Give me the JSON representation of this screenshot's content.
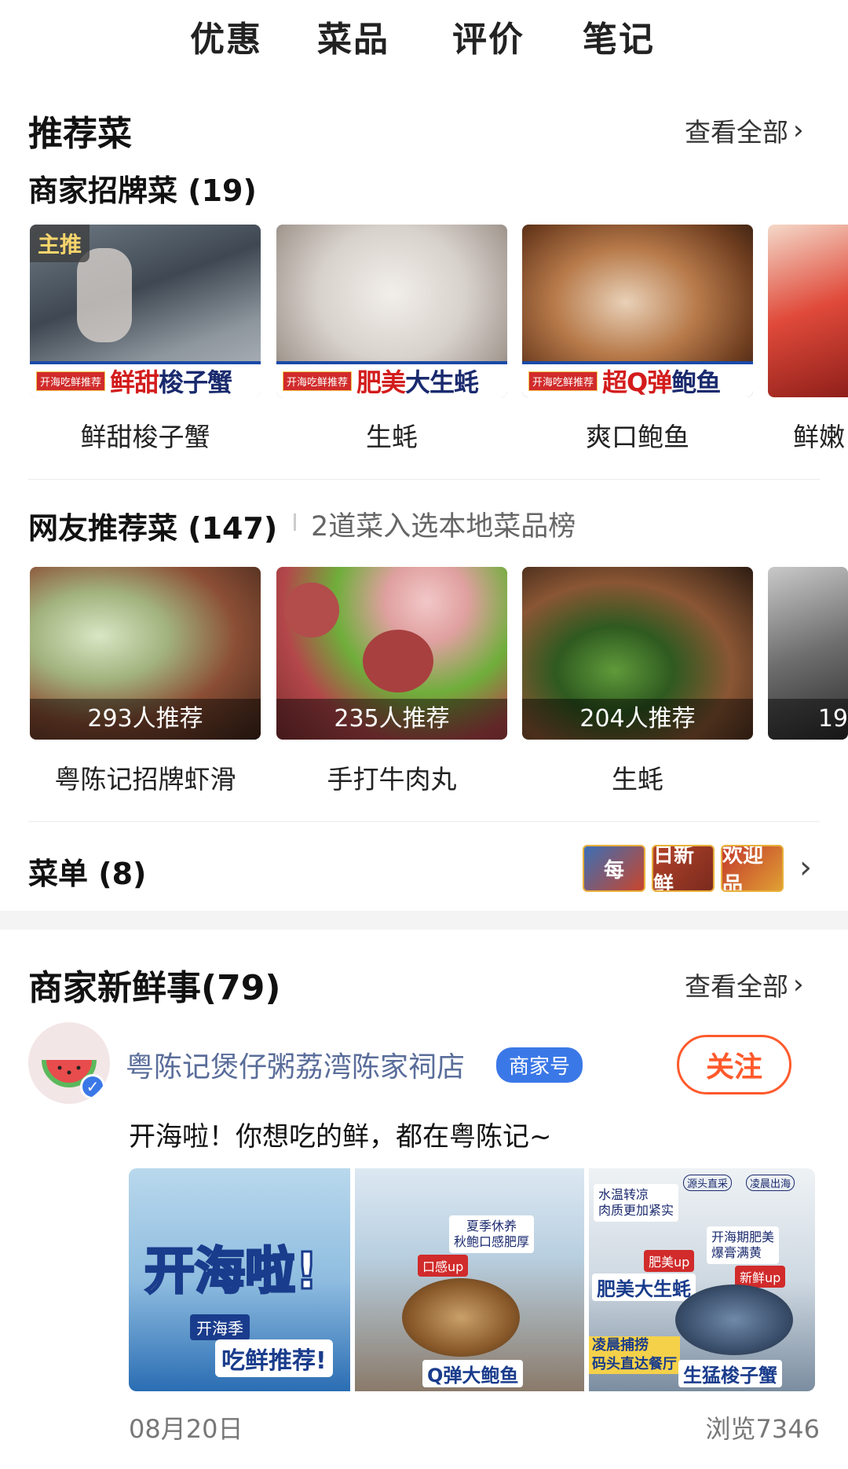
{
  "tabs": [
    "优惠",
    "菜品",
    "评价",
    "笔记"
  ],
  "recommend": {
    "title": "推荐菜",
    "view_all": "查看全部",
    "signature": {
      "title": "商家招牌菜 (19)",
      "items": [
        {
          "name": "鲜甜梭子蟹",
          "badge": "主推",
          "banner_tag": "开海吃鲜推荐",
          "banner_a": "鲜甜",
          "banner_b": "梭子蟹"
        },
        {
          "name": "生蚝",
          "badge": "",
          "banner_tag": "开海吃鲜推荐",
          "banner_a": "肥美",
          "banner_b": "大生蚝"
        },
        {
          "name": "爽口鲍鱼",
          "badge": "",
          "banner_tag": "开海吃鲜推荐",
          "banner_a": "超Q弹",
          "banner_b": "鲍鱼"
        },
        {
          "name": "鲜嫩",
          "badge": "",
          "banner_tag": "",
          "banner_a": "",
          "banner_b": ""
        }
      ]
    },
    "netizen": {
      "title": "网友推荐菜 (147)",
      "subtitle": "2道菜入选本地菜品榜",
      "items": [
        {
          "name": "粤陈记招牌虾滑",
          "count": "293人推荐"
        },
        {
          "name": "手打牛肉丸",
          "count": "235人推荐"
        },
        {
          "name": "生蚝",
          "count": "204人推荐"
        },
        {
          "name": "",
          "count": "19"
        }
      ]
    },
    "menu": {
      "title": "菜单 (8)",
      "thumbs": [
        "每",
        "日新鲜",
        "欢迎品"
      ]
    }
  },
  "news": {
    "title": "商家新鲜事(79)",
    "view_all": "查看全部",
    "shop_name": "粤陈记煲仔粥荔湾陈家祠店",
    "shop_tag": "商家号",
    "follow": "关注",
    "post_text": "开海啦！你想吃的鲜，都在粤陈记~",
    "poster": {
      "headline": "开海啦!",
      "sub_a": "开海季",
      "sub_b": "吃鲜推荐!",
      "panel2_a": "夏季休养",
      "panel2_b": "秋鲍口感肥厚",
      "panel2_tag": "口感up",
      "panel2_name": "Q弹大鲍鱼",
      "panel3_a": "水温转凉",
      "panel3_b": "肉质更加紧实",
      "panel3_tag": "肥美up",
      "panel3_name": "肥美大生蚝",
      "panel3_c": "凌晨捕捞",
      "panel3_d": "码头直达餐厅",
      "panel4_a": "源头直采",
      "panel4_b": "凌晨出海",
      "panel4_c": "开海期肥美",
      "panel4_d": "爆膏满黄",
      "panel4_tag": "新鲜up",
      "panel4_name": "生猛梭子蟹"
    },
    "date": "08月20日",
    "views": "浏览7346"
  },
  "colors": {
    "accent": "#ff5a2c",
    "shop_tag": "#3b78e7",
    "shop_name": "#5a6d9a"
  }
}
